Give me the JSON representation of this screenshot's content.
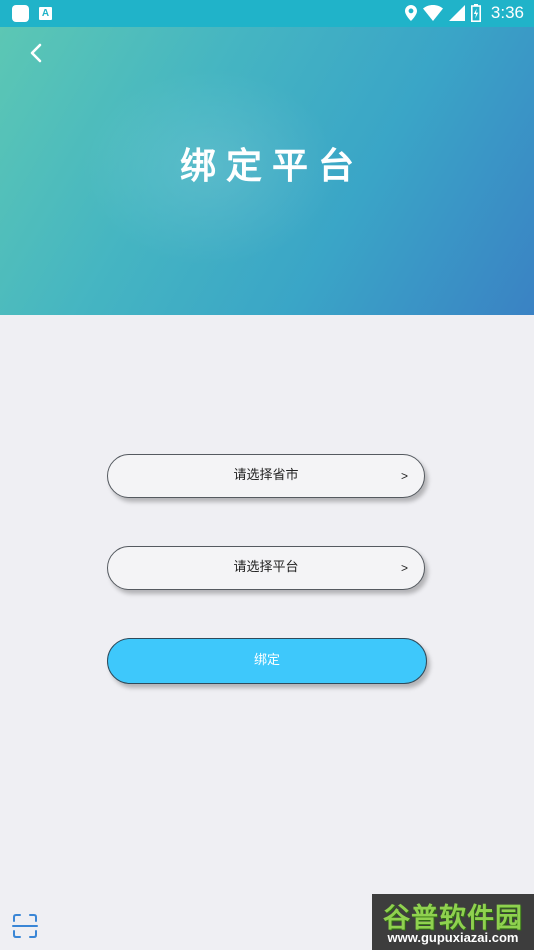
{
  "status_bar": {
    "time": "3:36",
    "icons": [
      "app-square-icon",
      "font-a-icon",
      "location-icon",
      "wifi-icon",
      "signal-icon",
      "battery-icon"
    ]
  },
  "header": {
    "title": "绑定平台",
    "back_icon": "chevron-left-icon"
  },
  "form": {
    "province_label": "请选择省市",
    "platform_label": "请选择平台",
    "chevron": ">",
    "bind_label": "绑定"
  },
  "footer": {
    "scan_icon": "scan-icon"
  },
  "watermark": {
    "title": "谷普软件园",
    "url": "www.gupuxiazai.com"
  },
  "colors": {
    "status_bar": "#20b3c9",
    "accent_button": "#3ec8fb",
    "page_background": "#efeff3"
  }
}
